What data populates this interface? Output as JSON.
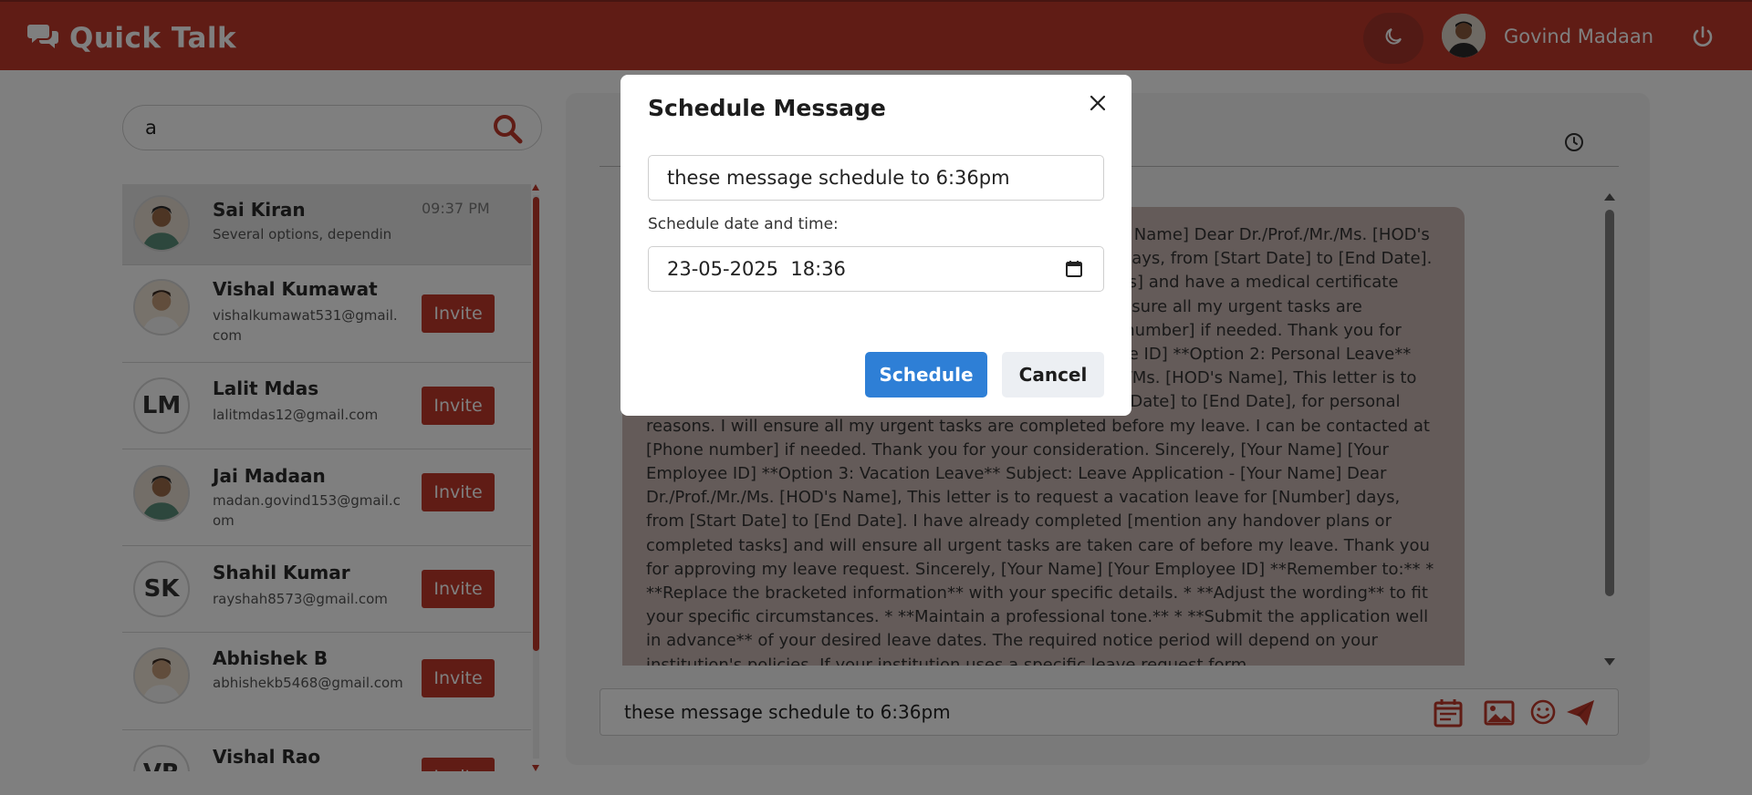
{
  "app": {
    "title": "Quick Talk",
    "user_name": "Govind Madaan"
  },
  "colors": {
    "brand": "#c0392b",
    "primary_button": "#2e7fd6"
  },
  "search": {
    "value": "a"
  },
  "contacts": [
    {
      "name": "Sai Kiran",
      "sub": "Several options, dependin",
      "time": "09:37 PM",
      "avatar": "photo"
    },
    {
      "name": "Vishal Kumawat",
      "sub": "vishalkumawat531@gmail.com",
      "invite": "Invite",
      "avatar": "photo"
    },
    {
      "name": "Lalit Mdas",
      "sub": "lalitmdas12@gmail.com",
      "invite": "Invite",
      "initials": "LM"
    },
    {
      "name": "Jai Madaan",
      "sub": "madan.govind153@gmail.com",
      "invite": "Invite",
      "avatar": "photo"
    },
    {
      "name": "Shahil Kumar",
      "sub": "rayshah8573@gmail.com",
      "invite": "Invite",
      "initials": "SK"
    },
    {
      "name": "Abhishek B",
      "sub": "abhishekb5468@gmail.com",
      "invite": "Invite",
      "avatar": "photo"
    },
    {
      "name": "Vishal Rao",
      "invite": "Invite",
      "initials": "VR"
    }
  ],
  "chat": {
    "message": "**Option 1: Sick Leave** Subject: Leave Application - [Your Name] Dear Dr./Prof./Mr./Ms. [HOD's Name], This letter is to request a sick leave for [Number] days, from [Start Date] to [End Date]. I am suffering from [Brief, non-specific description of illness] and have a medical certificate from my doctor. I apologize for any inconvenience. I will ensure all my urgent tasks are completed before my leave. I can be contacted at [Phone number] if needed. Thank you for your understanding. Sincerely, [Your Name] [Your Employee ID] **Option 2: Personal Leave** Subject: Leave Application - [Your Name] Dear Dr./Prof./Mr./Ms. [HOD's Name], This letter is to request a leave of absence for [Number] days, from [Start Date] to [End Date], for personal reasons. I will ensure all my urgent tasks are completed before my leave. I can be contacted at [Phone number] if needed. Thank you for your consideration. Sincerely, [Your Name] [Your Employee ID] **Option 3: Vacation Leave** Subject: Leave Application - [Your Name] Dear Dr./Prof./Mr./Ms. [HOD's Name], This letter is to request a vacation leave for [Number] days, from [Start Date] to [End Date]. I have already completed [mention any handover plans or completed tasks] and will ensure all urgent tasks are taken care of before my leave. Thank you for approving my leave request. Sincerely, [Your Name] [Your Employee ID] **Remember to:** * **Replace the bracketed information** with your specific details. * **Adjust the wording** to fit your specific circumstances. * **Maintain a professional tone.** * **Submit the application well in advance** of your desired leave dates. The required notice period will depend on your institution's policies. If your institution uses a specific leave request form",
    "composer_value": "these message schedule to 6:36pm"
  },
  "modal": {
    "title": "Schedule Message",
    "message_value": "these message schedule to 6:36pm",
    "datetime_label": "Schedule date and time:",
    "datetime_value": "23-05-2025  18:36",
    "schedule_label": "Schedule",
    "cancel_label": "Cancel"
  }
}
